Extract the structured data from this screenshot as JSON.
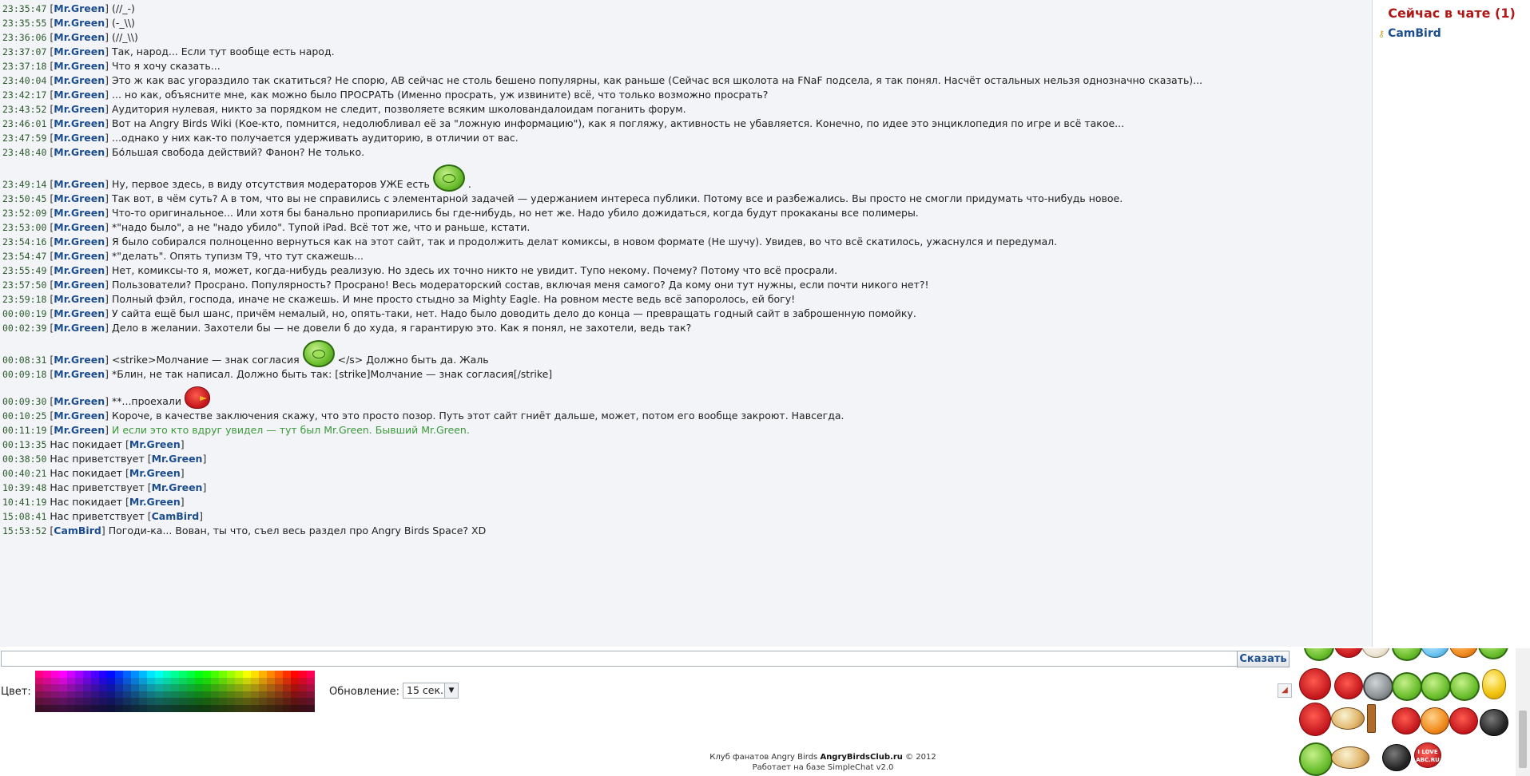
{
  "chat": {
    "messages": [
      {
        "time": "23:35:47",
        "nick": "Mr.Green",
        "text": "(//_-)"
      },
      {
        "time": "23:35:55",
        "nick": "Mr.Green",
        "text": "(-_\\\\)"
      },
      {
        "time": "23:36:06",
        "nick": "Mr.Green",
        "text": "(//_\\\\)"
      },
      {
        "time": "23:37:07",
        "nick": "Mr.Green",
        "text": "Так, народ... Если тут вообще есть народ."
      },
      {
        "time": "23:37:18",
        "nick": "Mr.Green",
        "text": "Что я хочу сказать..."
      },
      {
        "time": "23:40:04",
        "nick": "Mr.Green",
        "text": "Это ж как вас угораздило так скатиться? Не спорю, AB сейчас не столь бешено популярны, как раньше (Сейчас вся школота на FNaF подсела, я так понял. Насчёт остальных нельзя однозначно сказать)..."
      },
      {
        "time": "23:42:17",
        "nick": "Mr.Green",
        "text": "... но как, объясните мне, как можно было ПРОСРАТЬ (Именно просрать, уж извините) всё, что только возможно просрать?"
      },
      {
        "time": "23:43:52",
        "nick": "Mr.Green",
        "text": "Аудитория нулевая, никто за порядком не следит, позволяете всяким школовандалоидам поганить форум."
      },
      {
        "time": "23:46:01",
        "nick": "Mr.Green",
        "text": "Вот на Angry Birds Wiki (Кое-кто, помнится, недолюбливал её за \"ложную информацию\"), как я погляжу, активность не убавляется. Конечно, по идее это энциклопедия по игре и всё такое..."
      },
      {
        "time": "23:47:59",
        "nick": "Mr.Green",
        "text": "...однако у них как-то получается удерживать аудиторию, в отличии от вас."
      },
      {
        "time": "23:48:40",
        "nick": "Mr.Green",
        "text": "Бо́льшая свобода действий? Фанон? Не только."
      },
      {
        "time": "23:49:14",
        "nick": "Mr.Green",
        "text": "Ну, первое здесь, в виду отсутствия модераторов УЖЕ есть",
        "emote": "pig",
        "after": "."
      },
      {
        "time": "23:50:45",
        "nick": "Mr.Green",
        "text": "Так вот, в чём суть? А в том, что вы не справились с элементарной задачей — удержанием интереса публики. Потому все и разбежались. Вы просто не смогли придумать что-нибудь новое."
      },
      {
        "time": "23:52:09",
        "nick": "Mr.Green",
        "text": "Что-то оригинальное... Или хотя бы банально пропиарились бы где-нибудь, но нет же. Надо убило дожидаться, когда будут прокаканы все полимеры."
      },
      {
        "time": "23:53:00",
        "nick": "Mr.Green",
        "text": "*\"надо было\", а не \"надо убило\". Тупой iPad. Всё тот же, что и раньше, кстати."
      },
      {
        "time": "23:54:16",
        "nick": "Mr.Green",
        "text": "Я было собирался полноценно вернуться как на этот сайт, так и продолжить делат комиксы, в новом формате (Не шучу). Увидев, во что всё скатилось, ужаснулся и передумал."
      },
      {
        "time": "23:54:47",
        "nick": "Mr.Green",
        "text": "*\"делать\". Опять тупизм Т9, что тут скажешь..."
      },
      {
        "time": "23:55:49",
        "nick": "Mr.Green",
        "text": "Нет, комиксы-то я, может, когда-нибудь реализую. Но здесь их точно никто не увидит. Тупо некому. Почему? Потому что всё просрали."
      },
      {
        "time": "23:57:50",
        "nick": "Mr.Green",
        "text": "Пользователи? Просрано. Популярность? Просрано! Весь модераторский состав, включая меня самого? Да кому они тут нужны, если почти никого нет?!"
      },
      {
        "time": "23:59:18",
        "nick": "Mr.Green",
        "text": "Полный фэйл, господа, иначе не скажешь. И мне просто стыдно за Mighty Eagle. На ровном месте ведь всё запоролось, ей богу!"
      },
      {
        "time": "00:00:19",
        "nick": "Mr.Green",
        "text": "У сайта ещё был шанс, причём немалый, но, опять-таки, нет. Надо было доводить дело до конца — превращать годный сайт в заброшенную помойку."
      },
      {
        "time": "00:02:39",
        "nick": "Mr.Green",
        "text": "Дело в желании. Захотели бы — не довели б до худа, я гарантирую это. Как я понял, не захотели, ведь так?"
      },
      {
        "time": "00:08:31",
        "nick": "Mr.Green",
        "text": "<strike>Молчание — знак согласия",
        "emote": "pig",
        "after": "</s> Должно быть да. Жаль"
      },
      {
        "time": "00:09:18",
        "nick": "Mr.Green",
        "text": "*Блин, не так написал. Должно быть так: [strike]Молчание — знак согласия[/strike]"
      },
      {
        "time": "00:09:30",
        "nick": "Mr.Green",
        "text": "**...проехали",
        "emote": "red"
      },
      {
        "time": "00:10:25",
        "nick": "Mr.Green",
        "text": "Короче, в качестве заключения скажу, что это просто позор. Путь этот сайт гниёт дальше, может, потом его вообще закроют. Навсегда."
      },
      {
        "time": "00:11:19",
        "nick": "Mr.Green",
        "text": "И если это кто вдруг увидел — тут был Mr.Green. Бывший Mr.Green.",
        "green": true
      }
    ],
    "events": [
      {
        "time": "00:13:35",
        "text": "Нас покидает ",
        "nick": "Mr.Green"
      },
      {
        "time": "00:38:50",
        "text": "Нас приветствует ",
        "nick": "Mr.Green"
      },
      {
        "time": "00:40:21",
        "text": "Нас покидает ",
        "nick": "Mr.Green"
      },
      {
        "time": "10:39:48",
        "text": "Нас приветствует ",
        "nick": "Mr.Green"
      },
      {
        "time": "10:41:19",
        "text": "Нас покидает ",
        "nick": "Mr.Green"
      },
      {
        "time": "15:08:41",
        "text": "Нас приветствует ",
        "nick": "CamBird"
      }
    ],
    "last": {
      "time": "15:53:52",
      "nick": "CamBird",
      "text": "Погоди-ка... Вован, ты что, съел весь раздел про Angry Birds Space? XD"
    }
  },
  "sidebar": {
    "title": "Сейчас в чате (1)",
    "users": [
      "CamBird"
    ]
  },
  "input": {
    "value": "",
    "send_label": "Сказать"
  },
  "controls": {
    "color_label": "Цвет:",
    "refresh_label": "Обновление:",
    "refresh_value": "15 сек."
  },
  "footer": {
    "line1_prefix": "Клуб фанатов Angry Birds ",
    "site": "AngryBirdsClub.ru",
    "line1_suffix": " © 2012",
    "line2": "Работает на базе SimpleChat v2.0"
  },
  "smileys": {
    "love_text": "I LOVE ABC.RU"
  }
}
